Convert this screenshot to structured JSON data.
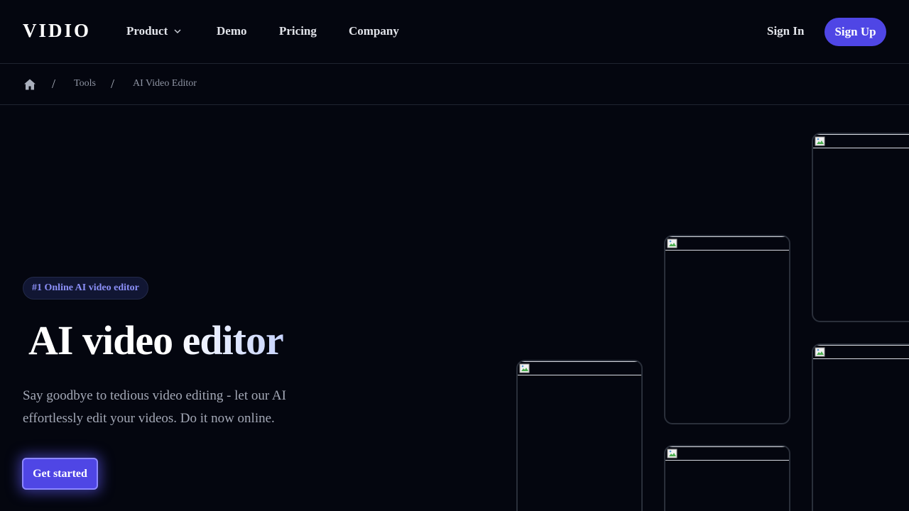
{
  "brand": {
    "logo_text": "VIDIO",
    "accent_color": "#4f46e5"
  },
  "nav": {
    "items": [
      {
        "label": "Product",
        "has_dropdown": true
      },
      {
        "label": "Demo"
      },
      {
        "label": "Pricing"
      },
      {
        "label": "Company"
      }
    ],
    "sign_in": "Sign In",
    "sign_up": "Sign Up"
  },
  "breadcrumb": {
    "home_icon": "home-icon",
    "separator": "/",
    "items": [
      "Tools",
      "AI Video Editor"
    ]
  },
  "hero": {
    "badge": "#1 Online AI video editor",
    "title": "AI video editor",
    "description": "Say goodbye to tedious video editing - let our AI effortlessly edit your videos. Do it now online.",
    "cta_label": "Get started"
  },
  "gallery": {
    "cards": [
      {
        "icon": "broken-image-icon"
      },
      {
        "icon": "broken-image-icon"
      },
      {
        "icon": "broken-image-icon"
      },
      {
        "icon": "broken-image-icon"
      },
      {
        "icon": "broken-image-icon"
      }
    ]
  }
}
